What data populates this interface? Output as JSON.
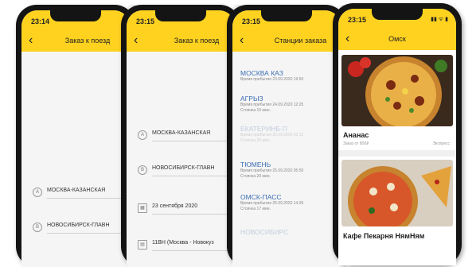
{
  "phones": [
    {
      "time": "23:14",
      "title": "Заказ к поезд",
      "rows": [
        {
          "text": "МОСКВА-КАЗАНСКАЯ"
        },
        {
          "text": "НОВОСИБИРСК-ГЛАВН"
        }
      ]
    },
    {
      "time": "23:15",
      "title": "Заказ к поезд",
      "rows": [
        {
          "text": "МОСКВА-КАЗАНСКАЯ"
        },
        {
          "text": "НОВОСИБИРСК-ГЛАВН"
        },
        {
          "text": "23 сентября 2020"
        },
        {
          "text": "11ВН (Москва - Новокуз"
        }
      ]
    },
    {
      "time": "23:15",
      "title": "Станции заказа",
      "stations": [
        {
          "name": "МОСКВА КАЗ",
          "arrival": "Время прибытия 23.09.2020 19:50",
          "stop": "",
          "dim": false
        },
        {
          "name": "АГРЫЗ",
          "arrival": "Время прибытия 24.09.2020 12:25",
          "stop": "Стоянка 15 мин.",
          "dim": false
        },
        {
          "name": "ЕКАТЕРИНБ-П",
          "arrival": "Время прибытия 25.09.2020 02:12",
          "stop": "Стоянка 20 мин.",
          "dim": true
        },
        {
          "name": "ТЮМЕНЬ",
          "arrival": "Время прибытия 25.09.2020 05:50",
          "stop": "Стоянка 20 мин.",
          "dim": false
        },
        {
          "name": "ОМСК-ПАСС",
          "arrival": "Время прибытия 25.09.2020 14:35",
          "stop": "Стоянка 17 мин.",
          "dim": false
        },
        {
          "name": "НОВОСИБИРС",
          "arrival": "",
          "stop": "",
          "dim": true
        }
      ]
    },
    {
      "time": "23:15",
      "title": "Омск",
      "signal": "▮▮ ᯤ ▮",
      "cards": [
        {
          "title": "Ананас",
          "subtitle": "Заказ от 800₽",
          "right": "Экспресс"
        },
        {
          "title": "Кафе Пекарня НямНям",
          "subtitle": "",
          "right": ""
        }
      ]
    }
  ],
  "colors": {
    "accent": "#ffd21f",
    "station_link": "#3c6fb4",
    "phone_body": "#141414"
  },
  "icons": {
    "back": "chevron-left-icon",
    "station": "circle-a-icon",
    "calendar": "calendar-icon",
    "train": "train-icon"
  }
}
